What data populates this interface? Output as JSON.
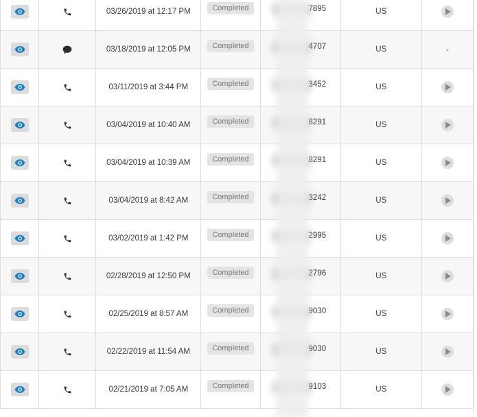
{
  "colors": {
    "eye_icon": "#1a7fc1",
    "type_icon": "#2b2b2b",
    "badge_bg": "#e4e4e4",
    "badge_text": "#777777",
    "play_icon": "#8a8a8a"
  },
  "rows": [
    {
      "type": "phone-icon",
      "datetime": "03/26/2019 at 12:17 PM",
      "status": "Completed",
      "number_tail": "7895",
      "country": "US",
      "recording": true
    },
    {
      "type": "chat-bubble-icon",
      "datetime": "03/18/2019 at 12:05 PM",
      "status": "Completed",
      "number_tail": "4707",
      "country": "US",
      "recording": false,
      "recording_text": "-"
    },
    {
      "type": "phone-icon",
      "datetime": "03/11/2019 at 3:44 PM",
      "status": "Completed",
      "number_tail": "3452",
      "country": "US",
      "recording": true
    },
    {
      "type": "phone-icon",
      "datetime": "03/04/2019 at 10:40 AM",
      "status": "Completed",
      "number_tail": "8291",
      "country": "US",
      "recording": true
    },
    {
      "type": "phone-icon",
      "datetime": "03/04/2019 at 10:39 AM",
      "status": "Completed",
      "number_tail": "8291",
      "country": "US",
      "recording": true
    },
    {
      "type": "phone-icon",
      "datetime": "03/04/2019 at 8:42 AM",
      "status": "Completed",
      "number_tail": "3242",
      "country": "US",
      "recording": true
    },
    {
      "type": "phone-icon",
      "datetime": "03/02/2019 at 1:42 PM",
      "status": "Completed",
      "number_tail": "2995",
      "country": "US",
      "recording": true
    },
    {
      "type": "phone-icon",
      "datetime": "02/28/2019 at 12:50 PM",
      "status": "Completed",
      "number_tail": "2796",
      "country": "US",
      "recording": true
    },
    {
      "type": "phone-icon",
      "datetime": "02/25/2019 at 8:57 AM",
      "status": "Completed",
      "number_tail": "9030",
      "country": "US",
      "recording": true
    },
    {
      "type": "phone-icon",
      "datetime": "02/22/2019 at 11:54 AM",
      "status": "Completed",
      "number_tail": "9030",
      "country": "US",
      "recording": true
    },
    {
      "type": "phone-icon",
      "datetime": "02/21/2019 at 7:05 AM",
      "status": "Completed",
      "number_tail": "9103",
      "country": "US",
      "recording": true
    }
  ]
}
